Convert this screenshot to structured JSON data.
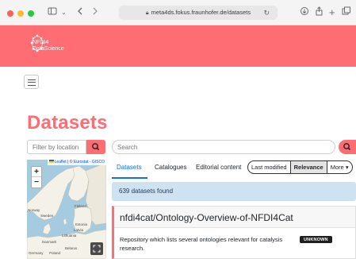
{
  "browser": {
    "url": "meta4ds.fokus.fraunhofer.de/datasets",
    "colors": {
      "close": "#fe5f57",
      "minimize": "#febc2e",
      "maximize": "#28c840"
    },
    "icons": [
      "sidebar-icon",
      "chevron-down-icon",
      "back-icon",
      "forward-icon",
      "lock-icon",
      "reload-icon",
      "download-icon",
      "share-icon",
      "new-tab-icon",
      "tabs-overview-icon"
    ]
  },
  "header": {
    "logo_line1": "NFDI4",
    "logo_line2": "DataScience",
    "brand_color": "#fe6d74"
  },
  "page": {
    "title": "Datasets"
  },
  "location": {
    "placeholder": "Filter by location"
  },
  "map": {
    "attribution_leaflet": "Leaflet",
    "attribution_sep": " | © ",
    "attribution_source": "Eurostat - GISCO",
    "zoom_in": "+",
    "zoom_out": "−",
    "labels": {
      "finland": "Finland",
      "norway": "Norway",
      "sweden": "Sweden",
      "estonia": "Estonia",
      "latvia": "Latvia",
      "lithuania": "Lithuania",
      "germany": "Germany",
      "poland": "Poland",
      "belarus": "Belarus",
      "denmark": "Danmark"
    }
  },
  "search": {
    "placeholder": "Search"
  },
  "tabs": [
    {
      "label": "Datasets",
      "active": true
    },
    {
      "label": "Catalogues",
      "active": false
    },
    {
      "label": "Editorial content",
      "active": false
    }
  ],
  "sort": {
    "options": [
      "Last modified",
      "Relevance"
    ],
    "selected": "Relevance",
    "more": "More ▾"
  },
  "results": {
    "count_text": "639 datasets found"
  },
  "dataset": {
    "title": "nfdi4cat/Ontology-Overview-of-NFDI4Cat",
    "description": "Repository which lists several ontologies relevant for catalysis research.",
    "license_badge": "UNKNOWN"
  }
}
